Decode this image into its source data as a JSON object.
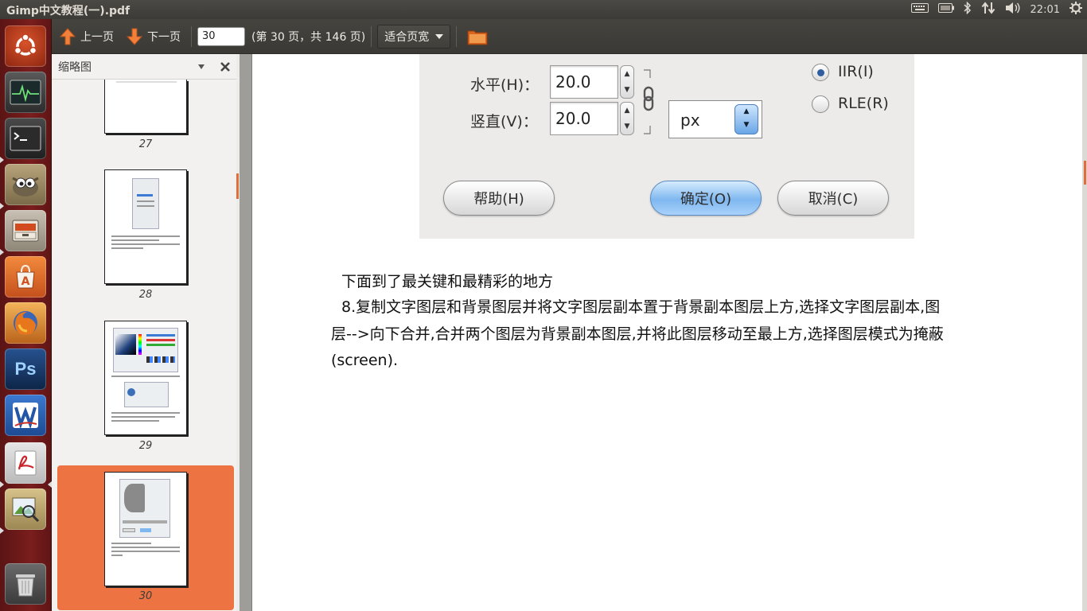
{
  "top_panel": {
    "window_title": "Gimp中文教程(一).pdf",
    "clock": "22:01",
    "tray_icons": [
      "keyboard-icon",
      "battery-icon",
      "bluetooth-icon",
      "network-icon",
      "volume-icon",
      "gear-icon"
    ]
  },
  "launcher": {
    "items": [
      "ubuntu-dash",
      "system-monitor",
      "terminal",
      "gimp",
      "file-manager",
      "software-center",
      "firefox",
      "photoshop",
      "wps-writer",
      "document-viewer",
      "image-viewer",
      "trash"
    ],
    "ps_label": "Ps"
  },
  "toolbar": {
    "prev_label": "上一页",
    "next_label": "下一页",
    "page_value": "30",
    "page_info": "(第 30 页，共 146 页)",
    "zoom_label": "适合页宽"
  },
  "sidebar": {
    "title": "缩略图",
    "thumbnails": [
      {
        "label": "27"
      },
      {
        "label": "28"
      },
      {
        "label": "29"
      },
      {
        "label": "30",
        "selected": true
      }
    ]
  },
  "document": {
    "dialog": {
      "horizontal_label": "水平(H)：",
      "vertical_label": "竖直(V)：",
      "horizontal_value": "20.0",
      "vertical_value": "20.0",
      "unit": "px",
      "radio_iir": "IIR(I)",
      "radio_rle": "RLE(R)",
      "help_button": "帮助(H)",
      "ok_button": "确定(O)",
      "cancel_button": "取消(C)"
    },
    "paragraph1": "下面到了最关键和最精彩的地方",
    "paragraph2_line1": "8.复制文字图层和背景图层并将文字图层副本置于背景副本图层上方,选择文字图层副本,图",
    "paragraph2_line2": "层-->向下合并,合并两个图层为背景副本图层,并将此图层移动至最上方,选择图层模式为掩蔽",
    "paragraph2_line3": "(screen)."
  },
  "colors": {
    "accent": "#ee7342",
    "launcher_bg": "#7a1d1d",
    "toolbar_bg": "#3c3b37"
  }
}
